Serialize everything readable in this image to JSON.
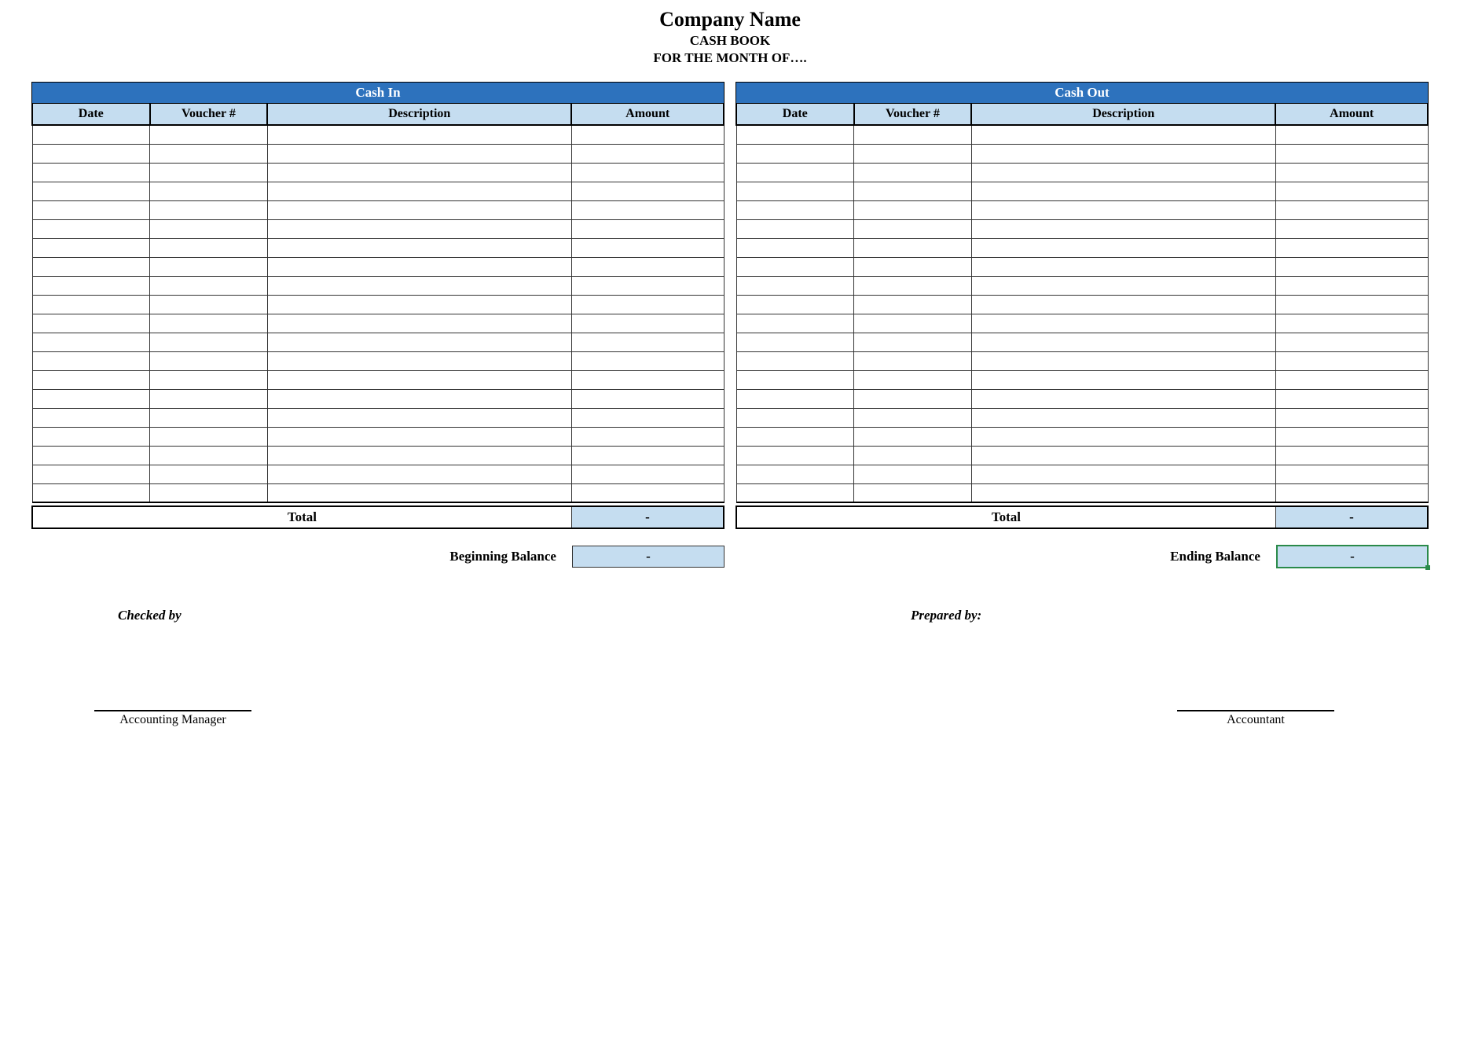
{
  "header": {
    "company_name": "Company Name",
    "title": "CASH BOOK",
    "subtitle": "FOR THE MONTH OF…."
  },
  "sections": {
    "cash_in": {
      "title": "Cash In",
      "columns": {
        "date": "Date",
        "voucher": "Voucher #",
        "description": "Description",
        "amount": "Amount"
      },
      "rows": [
        {
          "date": "",
          "voucher": "",
          "description": "",
          "amount": ""
        },
        {
          "date": "",
          "voucher": "",
          "description": "",
          "amount": ""
        },
        {
          "date": "",
          "voucher": "",
          "description": "",
          "amount": ""
        },
        {
          "date": "",
          "voucher": "",
          "description": "",
          "amount": ""
        },
        {
          "date": "",
          "voucher": "",
          "description": "",
          "amount": ""
        },
        {
          "date": "",
          "voucher": "",
          "description": "",
          "amount": ""
        },
        {
          "date": "",
          "voucher": "",
          "description": "",
          "amount": ""
        },
        {
          "date": "",
          "voucher": "",
          "description": "",
          "amount": ""
        },
        {
          "date": "",
          "voucher": "",
          "description": "",
          "amount": ""
        },
        {
          "date": "",
          "voucher": "",
          "description": "",
          "amount": ""
        },
        {
          "date": "",
          "voucher": "",
          "description": "",
          "amount": ""
        },
        {
          "date": "",
          "voucher": "",
          "description": "",
          "amount": ""
        },
        {
          "date": "",
          "voucher": "",
          "description": "",
          "amount": ""
        },
        {
          "date": "",
          "voucher": "",
          "description": "",
          "amount": ""
        },
        {
          "date": "",
          "voucher": "",
          "description": "",
          "amount": ""
        },
        {
          "date": "",
          "voucher": "",
          "description": "",
          "amount": ""
        },
        {
          "date": "",
          "voucher": "",
          "description": "",
          "amount": ""
        },
        {
          "date": "",
          "voucher": "",
          "description": "",
          "amount": ""
        },
        {
          "date": "",
          "voucher": "",
          "description": "",
          "amount": ""
        },
        {
          "date": "",
          "voucher": "",
          "description": "",
          "amount": ""
        }
      ],
      "total_label": "Total",
      "total_value": "-"
    },
    "cash_out": {
      "title": "Cash Out",
      "columns": {
        "date": "Date",
        "voucher": "Voucher #",
        "description": "Description",
        "amount": "Amount"
      },
      "rows": [
        {
          "date": "",
          "voucher": "",
          "description": "",
          "amount": ""
        },
        {
          "date": "",
          "voucher": "",
          "description": "",
          "amount": ""
        },
        {
          "date": "",
          "voucher": "",
          "description": "",
          "amount": ""
        },
        {
          "date": "",
          "voucher": "",
          "description": "",
          "amount": ""
        },
        {
          "date": "",
          "voucher": "",
          "description": "",
          "amount": ""
        },
        {
          "date": "",
          "voucher": "",
          "description": "",
          "amount": ""
        },
        {
          "date": "",
          "voucher": "",
          "description": "",
          "amount": ""
        },
        {
          "date": "",
          "voucher": "",
          "description": "",
          "amount": ""
        },
        {
          "date": "",
          "voucher": "",
          "description": "",
          "amount": ""
        },
        {
          "date": "",
          "voucher": "",
          "description": "",
          "amount": ""
        },
        {
          "date": "",
          "voucher": "",
          "description": "",
          "amount": ""
        },
        {
          "date": "",
          "voucher": "",
          "description": "",
          "amount": ""
        },
        {
          "date": "",
          "voucher": "",
          "description": "",
          "amount": ""
        },
        {
          "date": "",
          "voucher": "",
          "description": "",
          "amount": ""
        },
        {
          "date": "",
          "voucher": "",
          "description": "",
          "amount": ""
        },
        {
          "date": "",
          "voucher": "",
          "description": "",
          "amount": ""
        },
        {
          "date": "",
          "voucher": "",
          "description": "",
          "amount": ""
        },
        {
          "date": "",
          "voucher": "",
          "description": "",
          "amount": ""
        },
        {
          "date": "",
          "voucher": "",
          "description": "",
          "amount": ""
        },
        {
          "date": "",
          "voucher": "",
          "description": "",
          "amount": ""
        }
      ],
      "total_label": "Total",
      "total_value": "-"
    }
  },
  "balances": {
    "beginning": {
      "label": "Beginning Balance",
      "value": "-"
    },
    "ending": {
      "label": "Ending Balance",
      "value": "-"
    }
  },
  "signatures": {
    "checked_by": "Checked by",
    "prepared_by": "Prepared by:",
    "accounting_manager": "Accounting Manager",
    "accountant": "Accountant"
  }
}
